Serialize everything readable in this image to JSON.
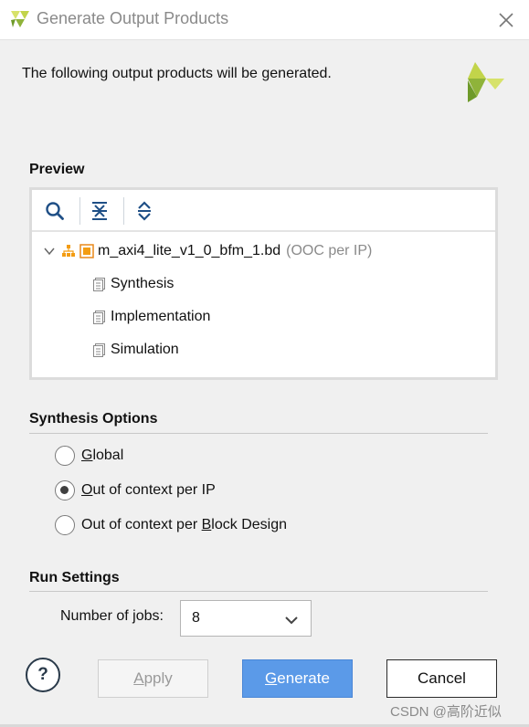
{
  "window": {
    "title": "Generate Output Products"
  },
  "intro_text": "The following output products will be generated.",
  "preview": {
    "section_title": "Preview",
    "toolbar": [
      "search-icon",
      "collapse-all-icon",
      "expand-all-icon"
    ],
    "tree": {
      "root": {
        "name": "m_axi4_lite_v1_0_bfm_1.bd",
        "suffix": "(OOC per IP)",
        "expanded": true
      },
      "children": [
        {
          "label": "Synthesis"
        },
        {
          "label": "Implementation"
        },
        {
          "label": "Simulation"
        }
      ]
    }
  },
  "synthesis_options": {
    "section_title": "Synthesis Options",
    "options": [
      {
        "label": "Global",
        "mnemonic": "G",
        "selected": false
      },
      {
        "label": "Out of context per IP",
        "mnemonic": "O",
        "selected": true
      },
      {
        "label": "Out of context per Block Design",
        "mnemonic": "B",
        "selected": false
      }
    ]
  },
  "run_settings": {
    "section_title": "Run Settings",
    "jobs_label": "Number of jobs:",
    "jobs_value": "8"
  },
  "buttons": {
    "help": "?",
    "apply": "Apply",
    "generate": "Generate",
    "cancel": "Cancel"
  },
  "watermark": "CSDN @高阶近似",
  "colors": {
    "accent_blue": "#5b9ae8",
    "logo_green": "#8fb33a",
    "logo_yellow": "#d7e26a",
    "tree_orange": "#f39c12",
    "icon_blue": "#1f4f86"
  }
}
